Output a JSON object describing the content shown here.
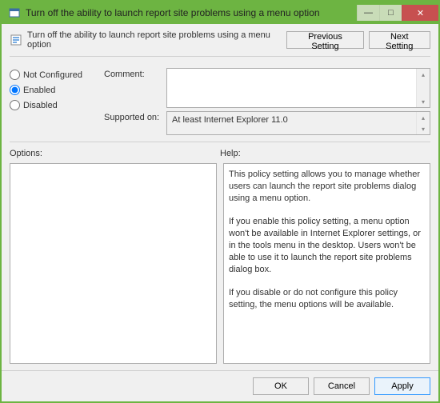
{
  "window": {
    "title": "Turn off the ability to launch report site problems using a menu option"
  },
  "titlebar_icons": {
    "minimize": "—",
    "maximize": "□",
    "close": "✕"
  },
  "header": {
    "policy_title": "Turn off the ability to launch report site problems using a menu option",
    "prev_btn": "Previous Setting",
    "next_btn": "Next Setting"
  },
  "radios": {
    "not_configured": "Not Configured",
    "enabled": "Enabled",
    "disabled": "Disabled",
    "selected": "enabled"
  },
  "fields": {
    "comment_label": "Comment:",
    "comment_value": "",
    "supported_label": "Supported on:",
    "supported_value": "At least Internet Explorer 11.0"
  },
  "panels": {
    "options_label": "Options:",
    "help_label": "Help:",
    "options_content": "",
    "help_content": "This policy setting allows you to manage whether users can launch the report site problems dialog using a menu option.\n\nIf you enable this policy setting, a menu option won't be available in Internet Explorer settings, or in the tools menu in the desktop. Users won't be able to use it to launch the report site problems dialog box.\n\nIf you disable or do not configure this policy setting, the menu options will be available."
  },
  "footer": {
    "ok": "OK",
    "cancel": "Cancel",
    "apply": "Apply"
  }
}
